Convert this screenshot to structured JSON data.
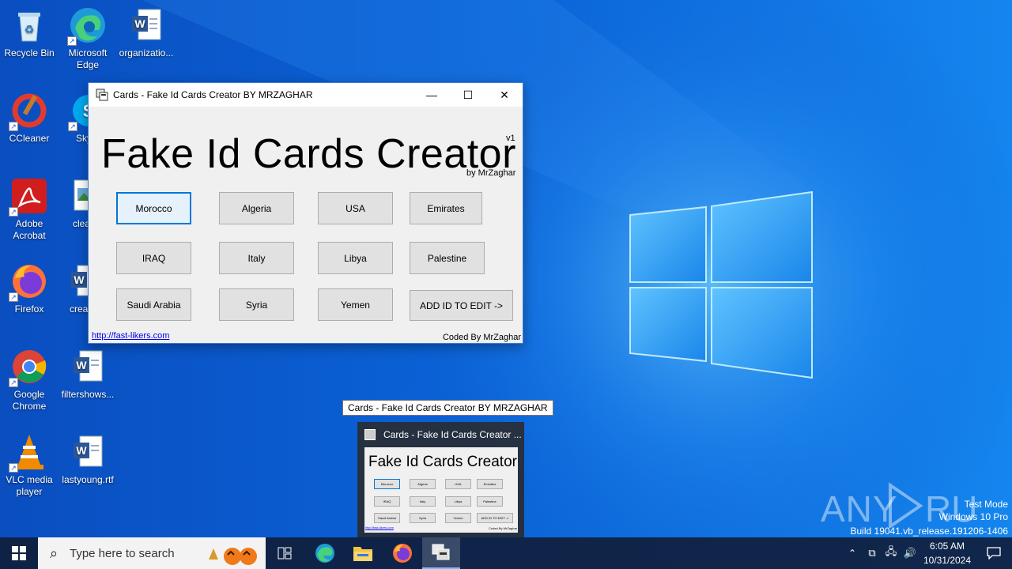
{
  "colors": {
    "desktop_accent": "#1585ee",
    "window_border": "#3b7bd6",
    "focus_blue": "#0078d7",
    "taskbar": "#101e3c"
  },
  "desktop": {
    "icons": [
      {
        "label": "Recycle Bin",
        "icon": "recycle-bin-icon"
      },
      {
        "label": "Microsoft Edge",
        "icon": "edge-icon"
      },
      {
        "label": "organizatio...",
        "icon": "word-doc-icon"
      },
      {
        "label": "CCleaner",
        "icon": "ccleaner-icon"
      },
      {
        "label": "Sky",
        "icon": "skype-icon"
      },
      {
        "label": "Adobe Acrobat",
        "icon": "acrobat-icon"
      },
      {
        "label": "cleanw",
        "icon": "image-file-icon"
      },
      {
        "label": "Firefox",
        "icon": "firefox-icon"
      },
      {
        "label": "createl",
        "icon": "word-doc-icon"
      },
      {
        "label": "Google Chrome",
        "icon": "chrome-icon"
      },
      {
        "label": "filtershows...",
        "icon": "word-doc-icon"
      },
      {
        "label": "VLC media player",
        "icon": "vlc-icon"
      },
      {
        "label": "lastyoung.rtf",
        "icon": "word-doc-icon"
      }
    ]
  },
  "window": {
    "title": "Cards - Fake Id Cards Creator BY MRZAGHAR",
    "minimize": "—",
    "maximize": "☐",
    "close": "✕",
    "heading": "Fake Id Cards Creator",
    "version": "v1",
    "byline": "by MrZaghar",
    "buttons": [
      "Morocco",
      "Algeria",
      "USA",
      "Emirates",
      "IRAQ",
      "Italy",
      "Libya",
      "Palestine",
      "Saudi Arabia",
      "Syria",
      "Yemen",
      "ADD ID TO EDIT ->"
    ],
    "link": "http://fast-likers.com",
    "coded_by": "Coded By MrZaghar"
  },
  "tooltip": "Cards - Fake Id Cards Creator BY MRZAGHAR",
  "thumbnail": {
    "title": "Cards - Fake Id Cards Creator ...",
    "heading": "Fake Id Cards Creator",
    "buttons": [
      "Morocco",
      "Algeria",
      "USA",
      "Emirates",
      "IRAQ",
      "Italy",
      "Libya",
      "Palestine",
      "Saudi Arabia",
      "Syria",
      "Yemen",
      "ADD ID TO EDIT ->"
    ],
    "link": "http://fast-likers.com",
    "coded_by": "Coded By MrZaghar"
  },
  "watermark": {
    "brand": "ANY RUN",
    "mode": "Test Mode",
    "edition": "Windows 10 Pro",
    "build": "Build 19041.vb_release.191206-1406"
  },
  "taskbar": {
    "search_placeholder": "Type here to search",
    "time": "6:05 AM",
    "date": "10/31/2024"
  }
}
